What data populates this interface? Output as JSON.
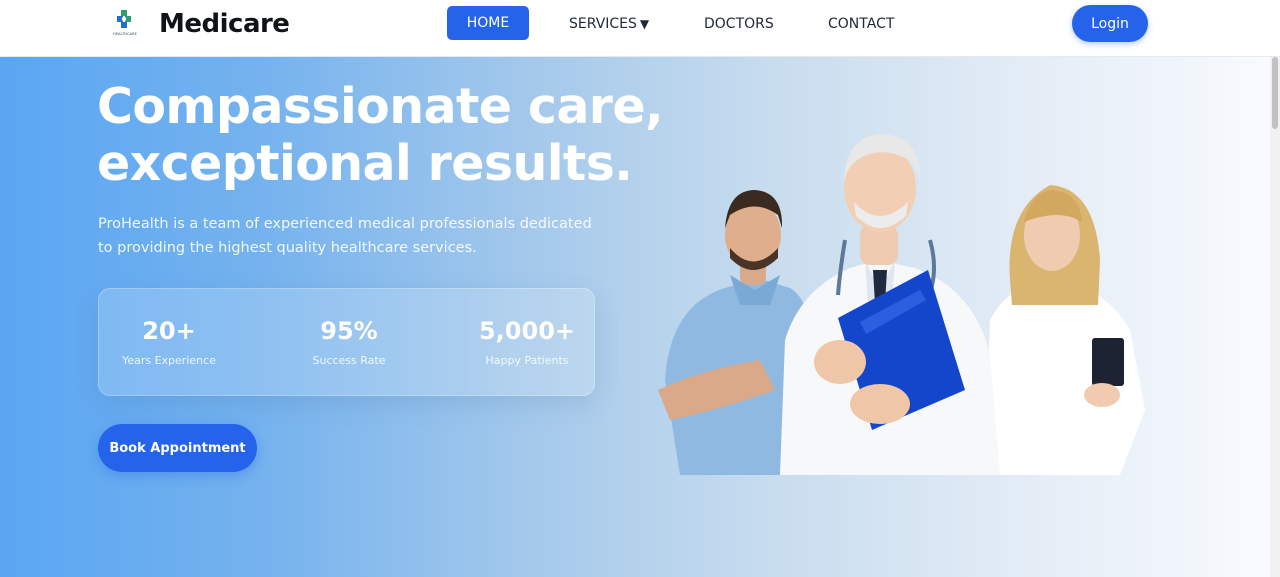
{
  "nav": {
    "brand": "Medicare",
    "logo_caption": "HEALTHCARE",
    "logo_icon": "medical-cross-icon",
    "links": {
      "home": "HOME",
      "services": "SERVICES",
      "services_caret": "▼",
      "doctors": "DOCTORS",
      "contact": "CONTACT"
    },
    "login": "Login"
  },
  "hero": {
    "headline_line1": "Compassionate care,",
    "headline_line2": "exceptional results.",
    "subtext": "ProHealth is a team of experienced medical professionals dedicated to providing the highest quality healthcare services.",
    "stats": [
      {
        "value": "20+",
        "label": "Years Experience"
      },
      {
        "value": "95%",
        "label": "Success Rate"
      },
      {
        "value": "5,000+",
        "label": "Happy Patients"
      }
    ],
    "cta": "Book Appointment"
  },
  "colors": {
    "accent": "#2563eb",
    "hero_gradient_start": "#5aa6f3",
    "hero_gradient_end": "#f9fbfe",
    "brand_text": "#10131a"
  }
}
